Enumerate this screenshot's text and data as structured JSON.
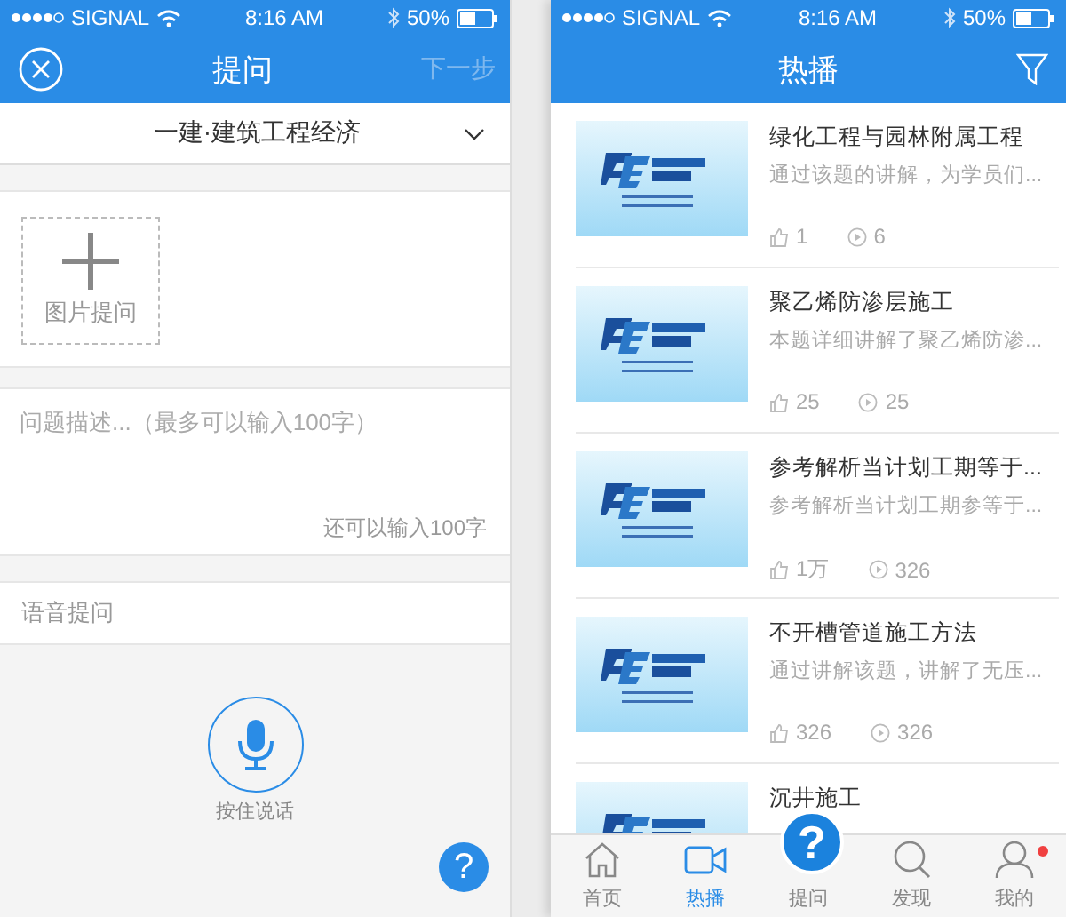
{
  "left_screen": {
    "status_bar": {
      "carrier": "SIGNAL",
      "time": "8:16 AM",
      "battery": "50%"
    },
    "nav": {
      "title": "提问",
      "next": "下一步",
      "next_disabled": true
    },
    "subject": "一建·建筑工程经济",
    "photo_button": "图片提问",
    "description": {
      "placeholder": "问题描述...（最多可以输入100字）",
      "counter": "还可以输入100字"
    },
    "voice": {
      "label": "语音提问",
      "hint": "按住说话"
    },
    "help": "?"
  },
  "right_screen": {
    "status_bar": {
      "carrier": "SIGNAL",
      "time": "8:16 AM",
      "battery": "50%"
    },
    "nav": {
      "title": "热播"
    },
    "items": [
      {
        "title": "绿化工程与园林附属工程",
        "description": "通过该题的讲解，为学员们...",
        "likes": "1",
        "plays": "6"
      },
      {
        "title": "聚乙烯防渗层施工",
        "description": "本题详细讲解了聚乙烯防渗...",
        "likes": "25",
        "plays": "25"
      },
      {
        "title": "参考解析当计划工期等于...",
        "description": "参考解析当计划工期参等于...",
        "likes": "1万",
        "plays": "326"
      },
      {
        "title": "不开槽管道施工方法",
        "description": "通过讲解该题，讲解了无压...",
        "likes": "326",
        "plays": "326"
      },
      {
        "title": "沉井施工"
      }
    ],
    "tab_bar": [
      {
        "kind": "home",
        "label": "首页",
        "selected": false,
        "badge": false
      },
      {
        "kind": "video",
        "label": "热播",
        "selected": true,
        "badge": false
      },
      {
        "kind": "ask",
        "label": "提问",
        "selected": false,
        "badge": false,
        "button": "?"
      },
      {
        "kind": "discover",
        "label": "发现",
        "selected": false,
        "badge": false
      },
      {
        "kind": "profile",
        "label": "我的",
        "selected": false,
        "badge": true
      }
    ]
  }
}
